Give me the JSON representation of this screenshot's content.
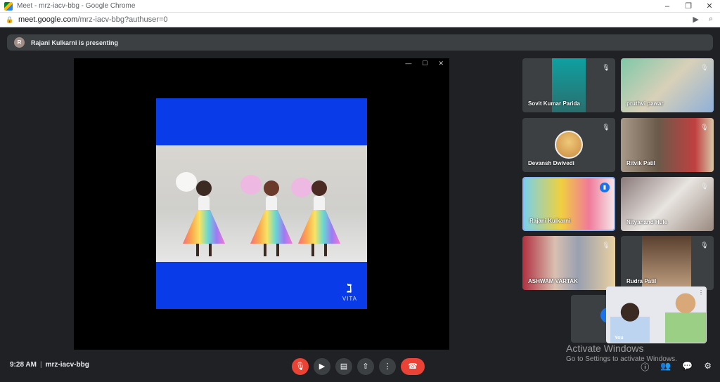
{
  "window": {
    "title": "Meet - mrz-iacv-bbg - Google Chrome",
    "url_host": "meet.google.com",
    "url_path": "/mrz-iacv-bbg?authuser=0"
  },
  "presenting": {
    "avatar_letter": "R",
    "text": "Rajani Kulkarni is presenting"
  },
  "presentation": {
    "logo_text": "VITA"
  },
  "participants": [
    {
      "name": "Sovit Kumar Parida",
      "muted": true
    },
    {
      "name": "pruthvi pawar",
      "muted": true
    },
    {
      "name": "Devansh Dwivedi",
      "muted": true
    },
    {
      "name": "Ritvik Patil",
      "muted": true
    },
    {
      "name": "Rajani Kulkarni",
      "muted": false,
      "speaking": true
    },
    {
      "name": "Nityanand Hule",
      "muted": true
    },
    {
      "name": "ASHWAM VARTAK",
      "muted": true
    },
    {
      "name": "Rudra Patil",
      "muted": true
    }
  ],
  "self_view": {
    "label": "You"
  },
  "footer": {
    "time": "9:28 AM",
    "meeting_code": "mrz-iacv-bbg"
  },
  "watermark": {
    "line1": "Activate Windows",
    "line2": "Go to Settings to activate Windows."
  },
  "colors": {
    "background": "#202124",
    "surface": "#3c4043",
    "danger": "#ea4335",
    "accent": "#1a73e8"
  }
}
